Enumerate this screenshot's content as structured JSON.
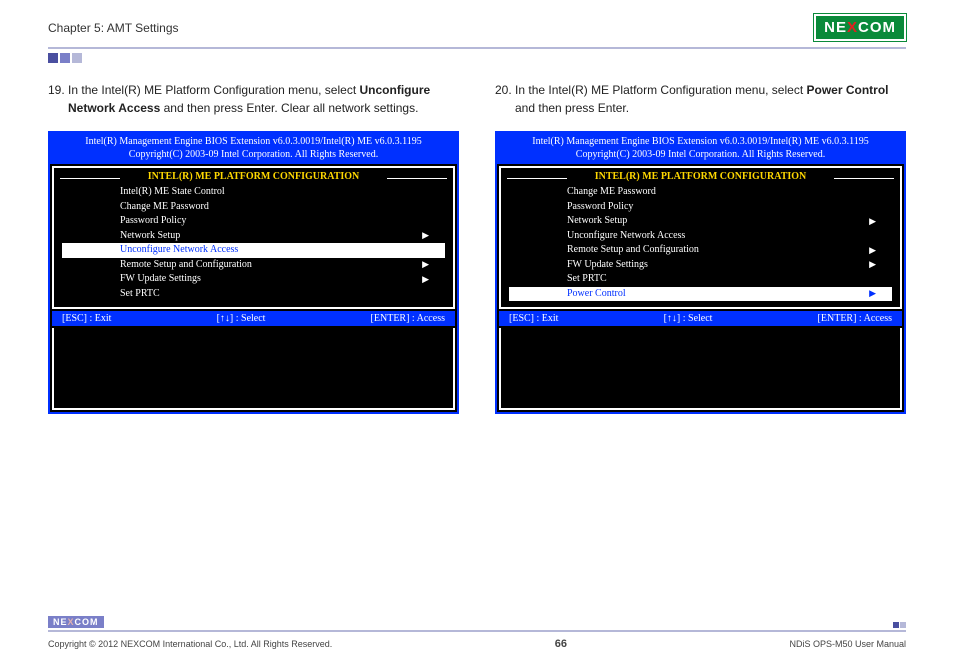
{
  "header": {
    "chapter": "Chapter 5: AMT Settings",
    "logo_pre": "NE",
    "logo_x": "X",
    "logo_post": "COM"
  },
  "left": {
    "step_num": "19.",
    "instr_1": "In the Intel(R) ME Platform Configuration menu, select ",
    "instr_bold": "Unconfigure Network Access",
    "instr_2": " and then press Enter. Clear all network settings.",
    "bios": {
      "line1": "Intel(R) Management Engine BIOS Extension v6.0.3.0019/Intel(R) ME v6.0.3.1195",
      "line2": "Copyright(C) 2003-09 Intel Corporation. All Rights Reserved.",
      "section": "INTEL(R) ME PLATFORM CONFIGURATION",
      "items": [
        {
          "label": "Intel(R) ME State Control",
          "arrow": false,
          "selected": false
        },
        {
          "label": "Change ME Password",
          "arrow": false,
          "selected": false
        },
        {
          "label": "Password Policy",
          "arrow": false,
          "selected": false
        },
        {
          "label": "Network Setup",
          "arrow": true,
          "selected": false
        },
        {
          "label": "Unconfigure Network Access",
          "arrow": false,
          "selected": true
        },
        {
          "label": "Remote Setup and Configuration",
          "arrow": true,
          "selected": false
        },
        {
          "label": "FW Update Settings",
          "arrow": true,
          "selected": false
        },
        {
          "label": "Set PRTC",
          "arrow": false,
          "selected": false
        }
      ],
      "esc": "[ESC] : Exit",
      "arrows": "[↑↓] : Select",
      "enter": "[ENTER] : Access"
    }
  },
  "right": {
    "step_num": "20.",
    "instr_1": "In the Intel(R) ME Platform Configuration menu, select ",
    "instr_bold": "Power Control",
    "instr_2": " and then press Enter.",
    "bios": {
      "line1": "Intel(R) Management Engine BIOS Extension v6.0.3.0019/Intel(R) ME v6.0.3.1195",
      "line2": "Copyright(C) 2003-09 Intel Corporation. All Rights Reserved.",
      "section": "INTEL(R) ME PLATFORM CONFIGURATION",
      "items": [
        {
          "label": "Change ME Password",
          "arrow": false,
          "selected": false
        },
        {
          "label": "Password Policy",
          "arrow": false,
          "selected": false
        },
        {
          "label": "Network Setup",
          "arrow": true,
          "selected": false
        },
        {
          "label": "Unconfigure Network Access",
          "arrow": false,
          "selected": false
        },
        {
          "label": "Remote Setup and Configuration",
          "arrow": true,
          "selected": false
        },
        {
          "label": "FW Update Settings",
          "arrow": true,
          "selected": false
        },
        {
          "label": "Set PRTC",
          "arrow": false,
          "selected": false
        },
        {
          "label": "Power Control",
          "arrow": true,
          "selected": true
        }
      ],
      "esc": "[ESC] : Exit",
      "arrows": "[↑↓] : Select",
      "enter": "[ENTER] : Access"
    }
  },
  "footer": {
    "logo_pre": "NE",
    "logo_x": "X",
    "logo_post": "COM",
    "copyright": "Copyright © 2012 NEXCOM International Co., Ltd. All Rights Reserved.",
    "page": "66",
    "doc": "NDiS OPS-M50 User Manual"
  }
}
